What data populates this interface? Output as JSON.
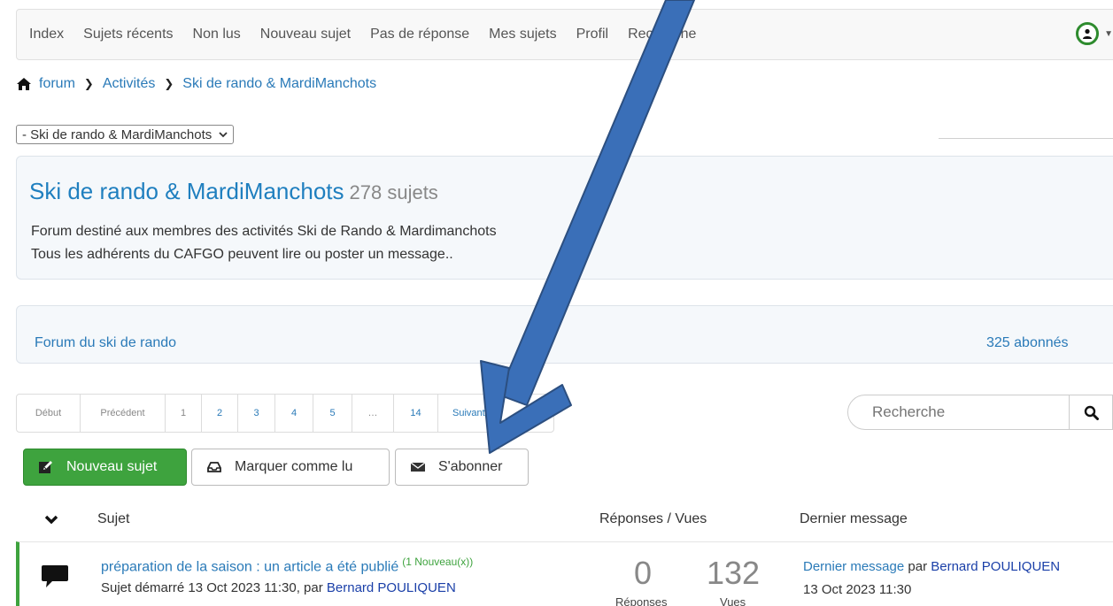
{
  "nav": {
    "items": [
      "Index",
      "Sujets récents",
      "Non lus",
      "Nouveau sujet",
      "Pas de réponse",
      "Mes sujets",
      "Profil",
      "Recherche"
    ]
  },
  "breadcrumb": {
    "items": [
      "forum",
      "Activités",
      "Ski de rando & MardiManchots"
    ]
  },
  "jump": {
    "selected": "- Ski de rando & MardiManchots"
  },
  "forum": {
    "title": "Ski de rando & MardiManchots",
    "count": "278 sujets",
    "desc_line1": "Forum destiné aux membres des activités Ski de Rando & Mardimanchots",
    "desc_line2": "Tous les adhérents du CAFGO peuvent lire ou poster un message.."
  },
  "subforum": {
    "name": "Forum du ski de rando",
    "subscribers": "325 abonnés"
  },
  "pagination": {
    "first": "Début",
    "prev": "Précédent",
    "pages": [
      "1",
      "2",
      "3",
      "4",
      "5",
      "…",
      "14"
    ],
    "next": "Suivant"
  },
  "search": {
    "placeholder": "Recherche"
  },
  "buttons": {
    "new_topic": "Nouveau sujet",
    "mark_read": "Marquer comme lu",
    "subscribe": "S'abonner"
  },
  "columns": {
    "subject": "Sujet",
    "replies_views": "Réponses / Vues",
    "last_message": "Dernier message"
  },
  "topic": {
    "title": "préparation de la saison : un article a été publié",
    "new_badge": "(1 Nouveau(x))",
    "meta_prefix": "Sujet démarré 13 Oct 2023 11:30, par",
    "author": "Bernard POULIQUEN",
    "replies": "0",
    "replies_label": "Réponses",
    "views": "132",
    "views_label": "Vues",
    "last_link": "Dernier message",
    "last_by": "par",
    "last_author": "Bernard POULIQUEN",
    "last_date": "13 Oct 2023 11:30"
  },
  "colors": {
    "accent_blue": "#2a7ab8",
    "green": "#3ea33e",
    "arrow": "#3a6fb8"
  }
}
